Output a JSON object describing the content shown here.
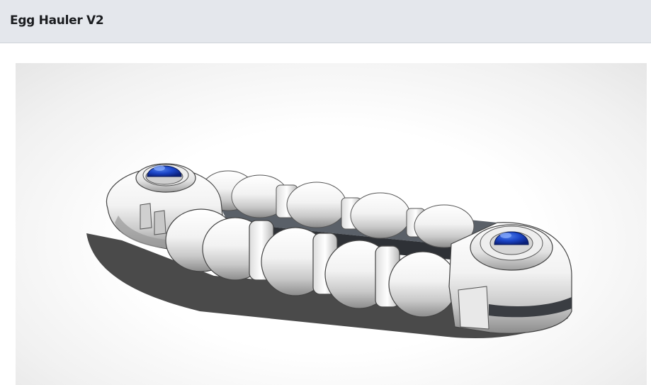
{
  "header": {
    "title": "Egg Hauler V2"
  },
  "viewer": {
    "model": "egg-hauler-3d-model"
  }
}
